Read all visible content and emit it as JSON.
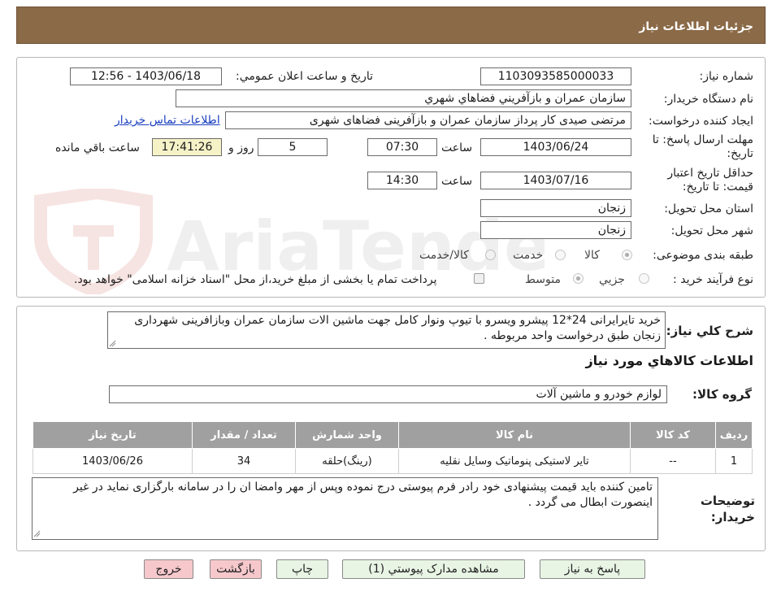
{
  "header": {
    "title": "جزئیات اطلاعات نیاز"
  },
  "need_number": {
    "label": "شماره نیاز:",
    "value": "1103093585000033"
  },
  "announce": {
    "label": "تاریخ و ساعت اعلان عمومي:",
    "value": "1403/06/18 - 12:56"
  },
  "buyer_org": {
    "label": "نام دستگاه خريدار:",
    "value": "سازمان عمران و بازآفريني فضاهاي شهري"
  },
  "requester": {
    "label": "ايجاد كننده درخواست:",
    "value": "مرتضی  صیدی  کار پرداز سازمان عمران و بازآفرینی فضاهای شهری",
    "contact_link": "اطلاعات تماس خريدار"
  },
  "reply_deadline": {
    "label": "مهلت ارسال پاسخ: تا تاريخ:",
    "date": "1403/06/24",
    "time_label": "ساعت",
    "time": "07:30",
    "days": "5",
    "days_label": "روز و",
    "remaining": "17:41:26",
    "remaining_label": "ساعت باقي مانده"
  },
  "price_validity": {
    "label": "حداقل تاريخ اعتبار قيمت: تا تاريخ:",
    "date": "1403/07/16",
    "time_label": "ساعت",
    "time": "14:30"
  },
  "province": {
    "label": "استان محل تحويل:",
    "value": "زنجان"
  },
  "city": {
    "label": "شهر محل تحويل:",
    "value": "زنجان"
  },
  "category": {
    "label": "طبقه بندی موضوعی:",
    "options": [
      "كالا",
      "خدمت",
      "كالا/خدمت"
    ]
  },
  "process": {
    "label": "نوع فرآيند خريد :",
    "options": [
      "جزيي",
      "متوسط"
    ],
    "note": "پرداخت تمام یا بخشی از مبلغ خرید،از محل \"اسناد خزانه اسلامی\" خواهد بود."
  },
  "description": {
    "label": "شرح كلي نياز:",
    "value": "خرید تایرایرانی 24*12 پیشرو ویسرو با تیوپ ونوار کامل جهت ماشین الات سازمان عمران وبازافرینی شهرداری زنجان طبق درخواست واحد مربوطه ."
  },
  "goods_section": {
    "title": "اطلاعات كالاهاي مورد نياز"
  },
  "goods_group": {
    "label": "گروه كالا:",
    "value": "لوازم خودرو و ماشين آلات"
  },
  "table": {
    "headers": [
      "رديف",
      "كد كالا",
      "نام كالا",
      "واحد شمارش",
      "تعداد / مقدار",
      "تاريخ نياز"
    ],
    "rows": [
      [
        "1",
        "--",
        "تایر لاستیکی پنوماتیک وسایل نقلیه",
        "(رينگ)حلقه",
        "34",
        "1403/06/26"
      ]
    ]
  },
  "buyer_notes": {
    "label": "توضيحات خريدار:",
    "value": "تامین کننده باید قیمت پیشنهادی خود رادر فرم پیوستی درج نموده  وپس از مهر وامضا ان را در سامانه بارگزاری نماید در غیر اینصورت ابطال می گردد ."
  },
  "buttons": {
    "reply": "پاسخ به نياز",
    "attachments": "مشاهده مدارک پيوستي (1)",
    "print": "چاپ",
    "back": "بازگشت",
    "exit": "خروج"
  },
  "watermark": {
    "text": "AriaTender.neT"
  },
  "colors": {
    "header_bg": "#8b6a47",
    "table_header_bg": "#a0a0a0",
    "button_bg": "#e8f4e4",
    "button_red_bg": "#f6c8cc",
    "link": "#1a3fbf"
  }
}
